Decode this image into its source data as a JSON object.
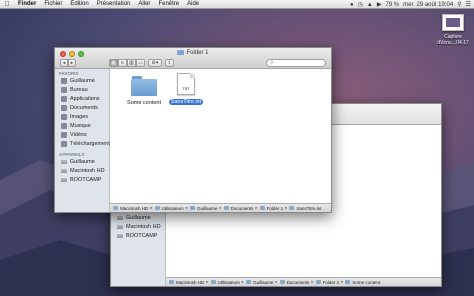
{
  "menubar": {
    "apple": "",
    "items": [
      "Finder",
      "Fichier",
      "Édition",
      "Présentation",
      "Aller",
      "Fenêtre",
      "Aide"
    ],
    "battery": "79 %",
    "clock": "mer. 29 août 19:04"
  },
  "desktop": {
    "screenshot_label_line1": "Capture",
    "screenshot_label_line2": "d'écra....04.17"
  },
  "front_window": {
    "title": "Folder 1",
    "sidebar": {
      "favorites_header": "FAVORIS",
      "favorites": [
        "Guillaume",
        "Bureau",
        "Applications",
        "Documents",
        "Images",
        "Musique",
        "Vidéos",
        "Téléchargements"
      ],
      "devices_header": "APPAREILS",
      "devices": [
        "Guillaume",
        "Macintosh HD",
        "BOOTCAMP"
      ]
    },
    "files": [
      {
        "name": "Some content",
        "kind": "folder",
        "selected": false
      },
      {
        "name": "SansTitre.txt",
        "kind": "txt",
        "badge": "TXT",
        "selected": true
      }
    ],
    "path": [
      "Macintosh HD",
      "Utilisateurs",
      "Guillaume",
      "Documents",
      "Folder 1",
      "SansTitre.txt"
    ]
  },
  "back_window": {
    "sidebar_devices": [
      "Guillaume",
      "Macintosh HD",
      "BOOTCAMP"
    ],
    "path": [
      "Macintosh HD",
      "Utilisateurs",
      "Guillaume",
      "Documents",
      "Folder 2",
      "Some content"
    ]
  },
  "colors": {
    "selection": "#3875d7",
    "sidebar_bg": "#dfe4ea",
    "close": "#f05a52",
    "minimize": "#f6bf2f",
    "zoom": "#5dc545"
  }
}
